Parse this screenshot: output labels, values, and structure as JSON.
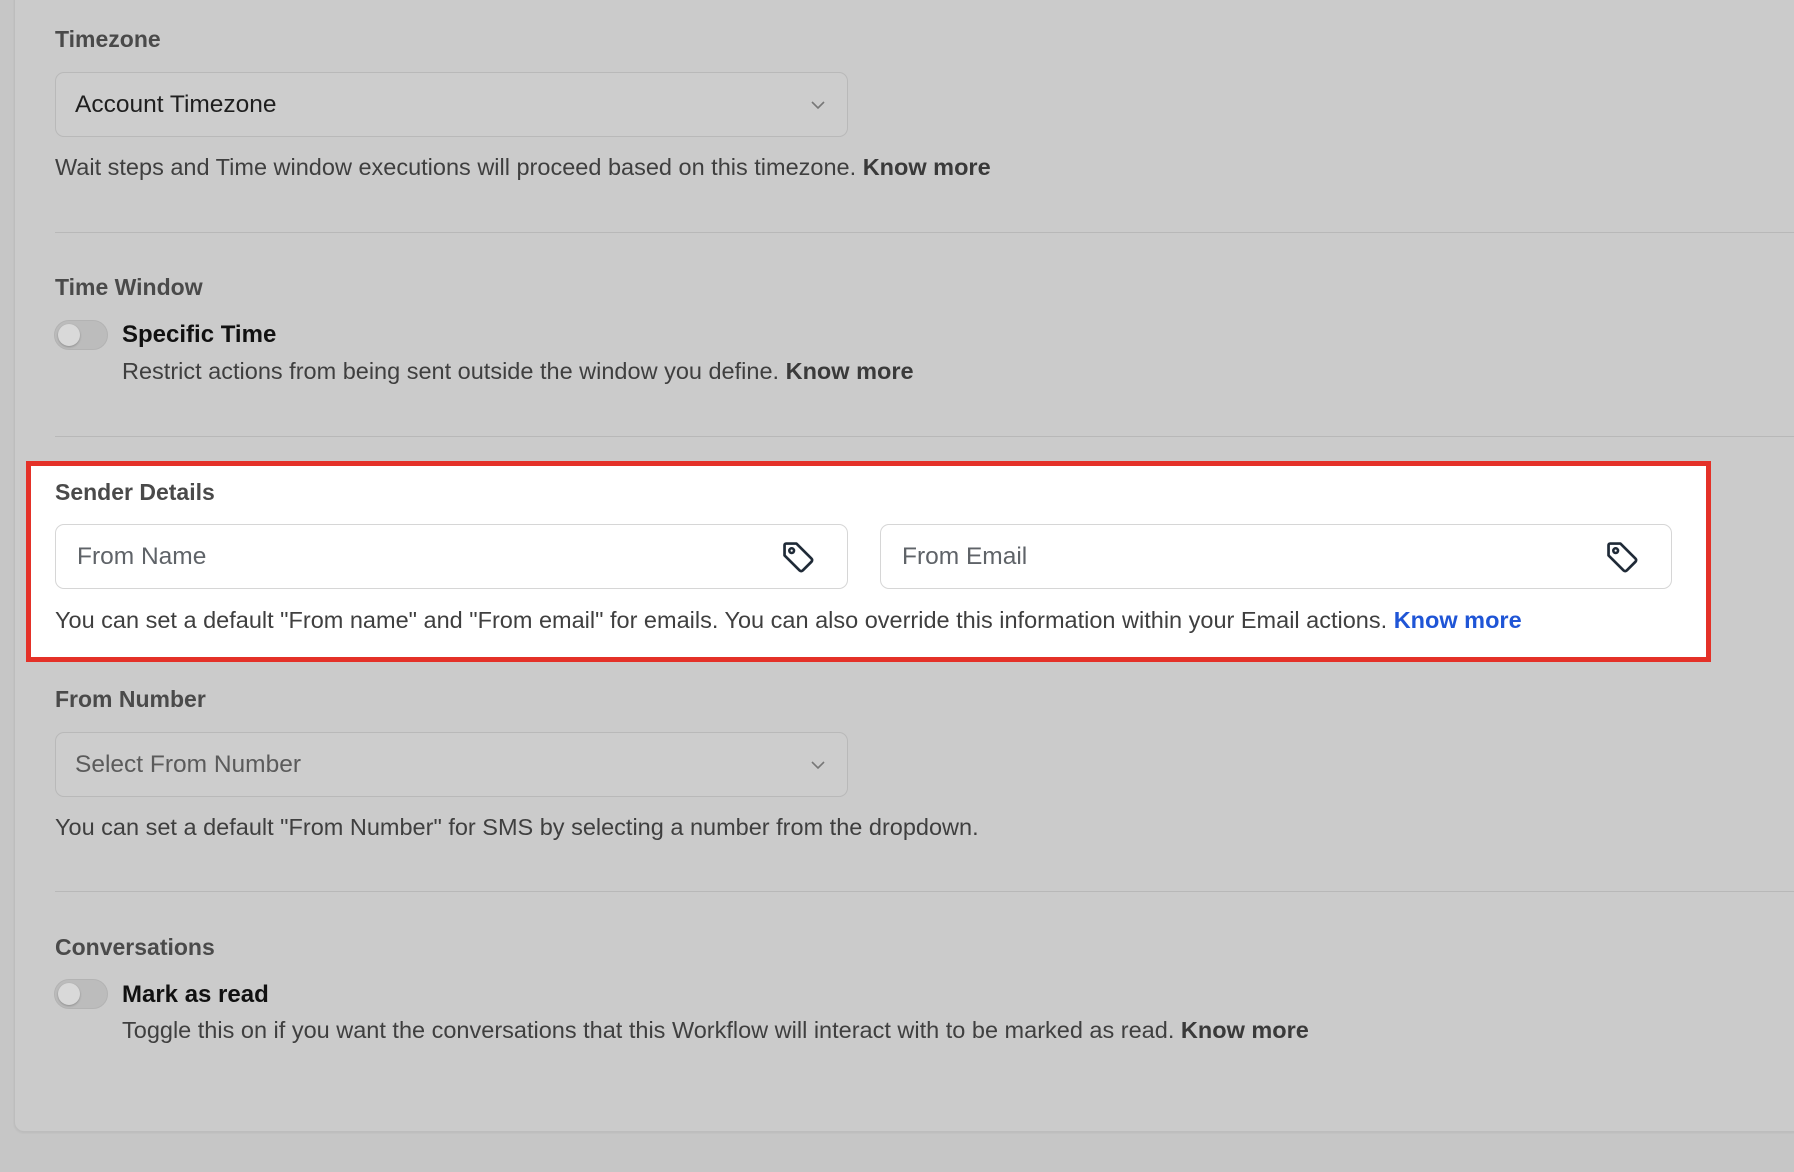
{
  "timezone": {
    "label": "Timezone",
    "selected": "Account Timezone",
    "help": "Wait steps and Time window executions will proceed based on this timezone.",
    "link": "Know more"
  },
  "time_window": {
    "label": "Time Window",
    "toggle_title": "Specific Time",
    "toggle_on": false,
    "help": "Restrict actions from being sent outside the window you define.",
    "link": "Know more"
  },
  "sender_details": {
    "label": "Sender Details",
    "from_name_placeholder": "From Name",
    "from_email_placeholder": "From Email",
    "help": "You can set a default \"From name\" and \"From email\" for emails. You can also override this information within your Email actions.",
    "link": "Know more",
    "icons": [
      "tag-icon",
      "tag-icon"
    ],
    "highlight_color": "#e43128",
    "link_color": "#1f55d6"
  },
  "from_number": {
    "label": "From Number",
    "placeholder": "Select From Number",
    "help": "You can set a default \"From Number\" for SMS by selecting a number from the dropdown."
  },
  "conversations": {
    "label": "Conversations",
    "toggle_title": "Mark as read",
    "toggle_on": false,
    "help": "Toggle this on if you want the conversations that this Workflow will interact with to be marked as read.",
    "link": "Know more"
  }
}
